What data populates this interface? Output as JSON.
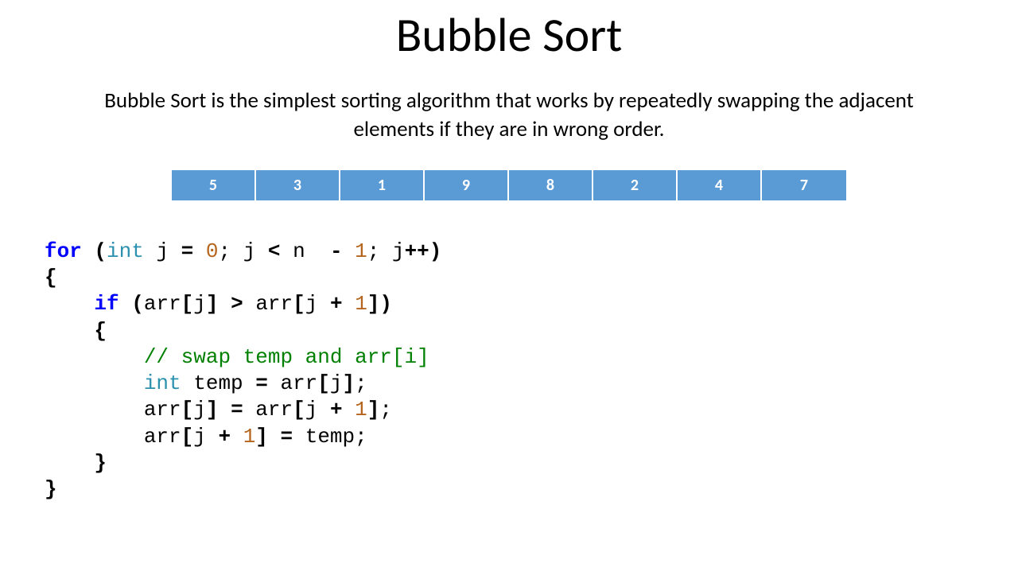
{
  "title": "Bubble Sort",
  "description": "Bubble Sort is the simplest sorting algorithm that works by repeatedly swapping the adjacent elements if they are in wrong order.",
  "array": [
    "5",
    "3",
    "1",
    "9",
    "8",
    "2",
    "4",
    "7"
  ],
  "code": {
    "line1": {
      "kw_for": "for",
      "paren_open": " (",
      "type_int": "int",
      "j_eq": " j ",
      "eq": "=",
      "sp1": " ",
      "zero": "0",
      "semi1": "; j ",
      "lt": "<",
      "n_minus": " n  ",
      "minus": "-",
      "sp2": " ",
      "one": "1",
      "semi2": "; j",
      "inc": "++",
      "paren_close": ")"
    },
    "line2": "{",
    "line3": {
      "indent": "    ",
      "kw_if": "if",
      "paren_open": " (",
      "arr1": "arr",
      "br1": "[",
      "j1": "j",
      "br2": "]",
      "sp1": " ",
      "gt": ">",
      "sp2": " arr",
      "br3": "[",
      "j2": "j ",
      "plus": "+",
      "sp3": " ",
      "one": "1",
      "br4": "]",
      "paren_close": ")"
    },
    "line4": "    {",
    "line5": {
      "indent": "        ",
      "comment": "// swap temp and arr[i]"
    },
    "line6": {
      "indent": "        ",
      "type_int": "int",
      "rest": " temp ",
      "eq": "=",
      "sp": " arr",
      "br1": "[",
      "j": "j",
      "br2": "]",
      "semi": ";"
    },
    "line7": {
      "indent": "        ",
      "arr": "arr",
      "br1": "[",
      "j1": "j",
      "br2": "]",
      "sp1": " ",
      "eq": "=",
      "sp2": " arr",
      "br3": "[",
      "j2": "j ",
      "plus": "+",
      "sp3": " ",
      "one": "1",
      "br4": "]",
      "semi": ";"
    },
    "line8": {
      "indent": "        ",
      "arr": "arr",
      "br1": "[",
      "j": "j ",
      "plus": "+",
      "sp": " ",
      "one": "1",
      "br2": "]",
      "sp2": " ",
      "eq": "=",
      "rest": " temp;"
    },
    "line9": "    }",
    "line10": "}"
  }
}
